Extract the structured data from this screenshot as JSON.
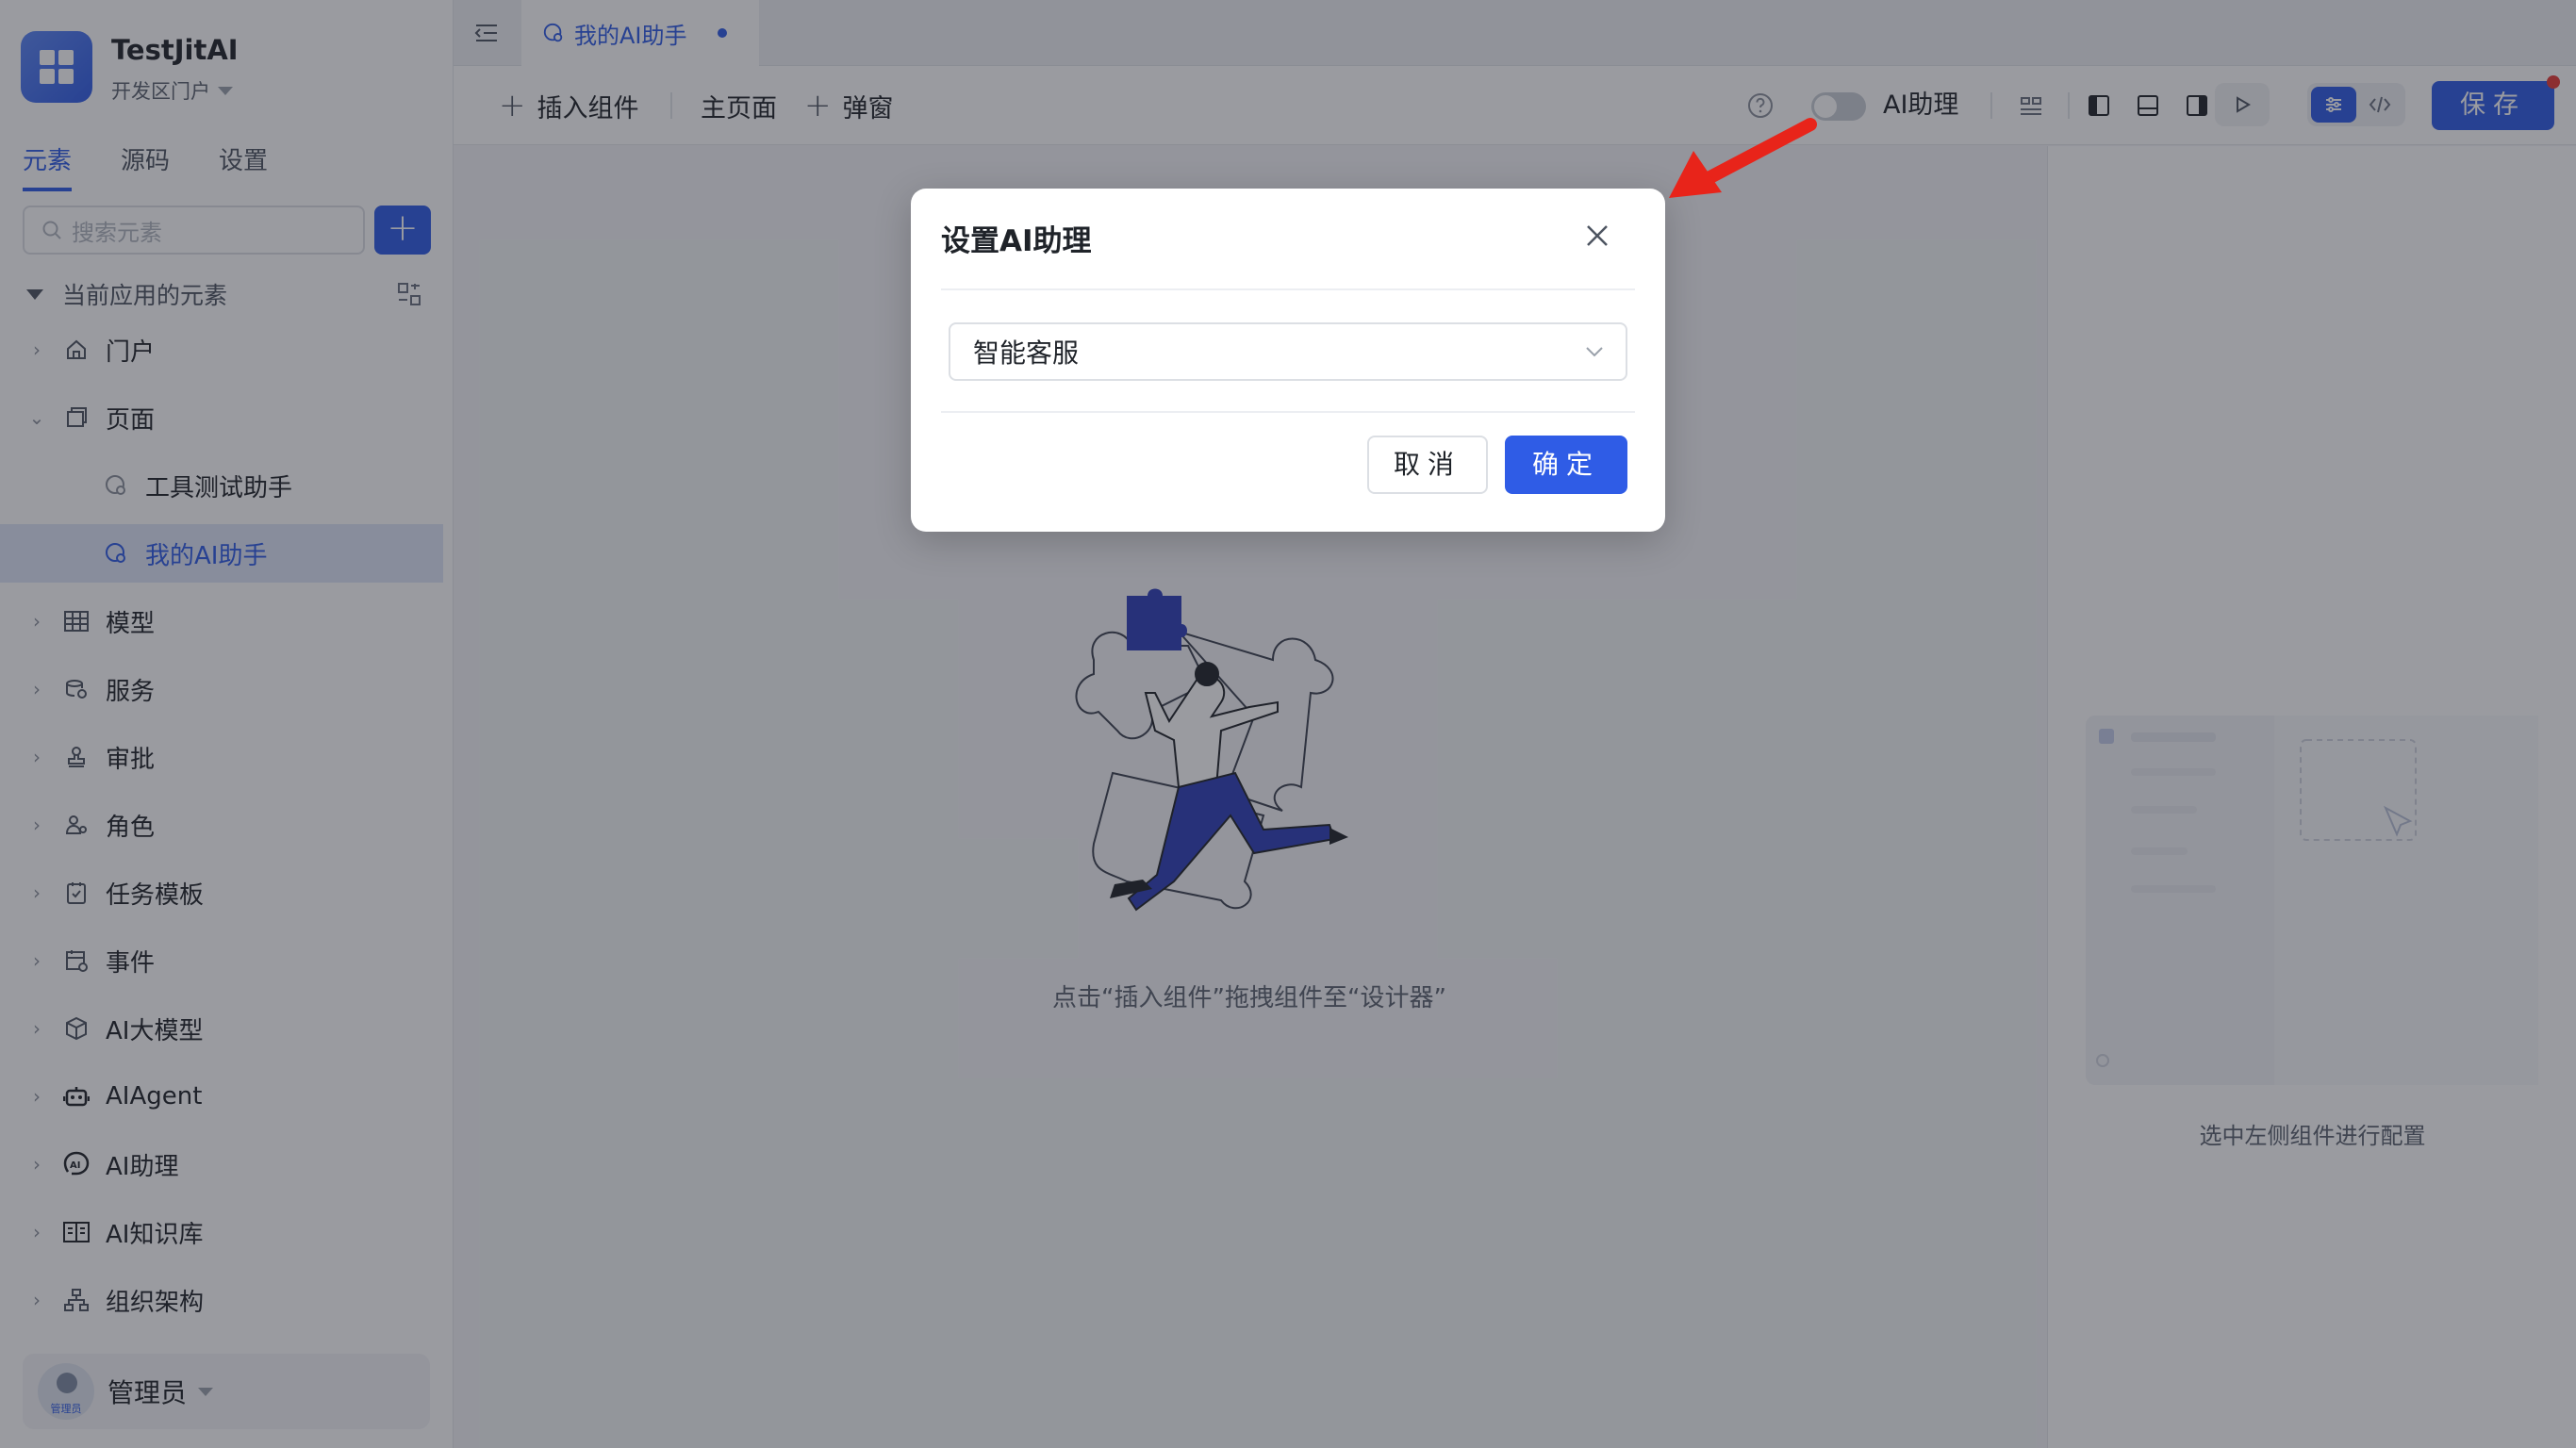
{
  "app": {
    "title": "TestJitAI",
    "portal": "开发区门户"
  },
  "sidebar": {
    "tabs": [
      {
        "label": "元素",
        "active": true
      },
      {
        "label": "源码",
        "active": false
      },
      {
        "label": "设置",
        "active": false
      }
    ],
    "search": {
      "placeholder": "搜索元素"
    },
    "section_title": "当前应用的元素",
    "items": [
      {
        "label": "门户",
        "icon": "home-icon"
      },
      {
        "label": "页面",
        "icon": "page-icon",
        "expanded": true
      },
      {
        "label": "工具测试助手",
        "icon": "ai-page-icon",
        "child": true
      },
      {
        "label": "我的AI助手",
        "icon": "ai-page-icon",
        "child": true,
        "selected": true
      },
      {
        "label": "模型",
        "icon": "table-icon"
      },
      {
        "label": "服务",
        "icon": "service-icon"
      },
      {
        "label": "审批",
        "icon": "stamp-icon"
      },
      {
        "label": "角色",
        "icon": "role-icon"
      },
      {
        "label": "任务模板",
        "icon": "task-icon"
      },
      {
        "label": "事件",
        "icon": "event-icon"
      },
      {
        "label": "AI大模型",
        "icon": "cube-icon"
      },
      {
        "label": "AIAgent",
        "icon": "robot-icon"
      },
      {
        "label": "AI助理",
        "icon": "ai-assistant-icon"
      },
      {
        "label": "AI知识库",
        "icon": "book-icon"
      },
      {
        "label": "组织架构",
        "icon": "org-icon"
      }
    ],
    "user": {
      "name": "管理员",
      "avatar_tag": "管理员"
    }
  },
  "tabbar": {
    "active_tab": "我的AI助手"
  },
  "toolbar": {
    "insert_component": "插入组件",
    "main_page": "主页面",
    "popup": "弹窗",
    "ai_toggle_label": "AI助理",
    "ai_toggle_on": false,
    "save": "保存"
  },
  "canvas": {
    "empty_hint": "点击“插入组件”拖拽组件至“设计器”"
  },
  "panel": {
    "hint": "选中左侧组件进行配置"
  },
  "modal": {
    "title": "设置AI助理",
    "selected_value": "智能客服",
    "cancel": "取消",
    "ok": "确定"
  },
  "colors": {
    "accent": "#2f5ce6",
    "arrow": "#e8241a",
    "overlay": "rgba(30,34,44,0.45)"
  }
}
